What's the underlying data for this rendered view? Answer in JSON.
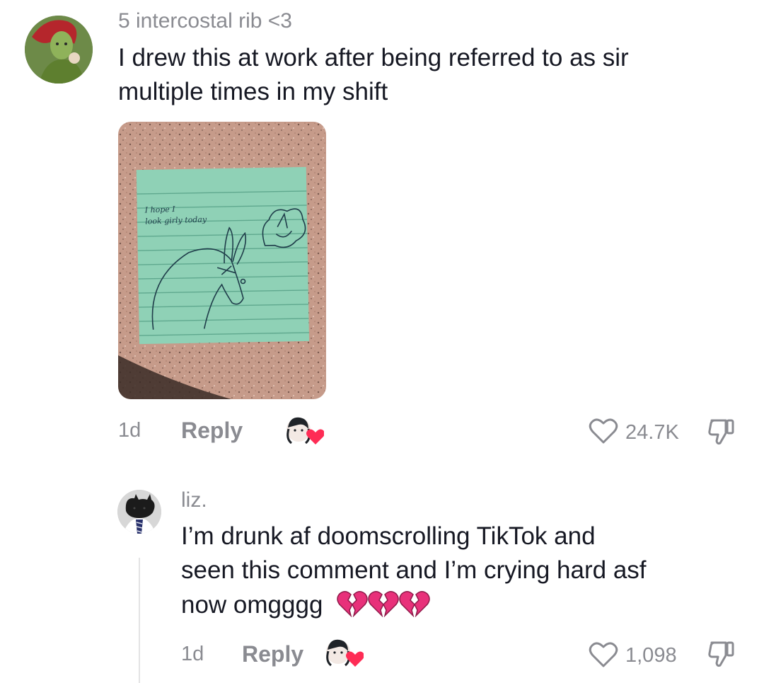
{
  "comments": [
    {
      "username": "5 intercostal rib <3",
      "text_line1": "I drew this at work after being referred to as sir",
      "text_line2": "multiple times in my shift",
      "image_alt": "sticky note drawing",
      "note_text_line1": "I hope I",
      "note_text_line2": "look girly today",
      "time": "1d",
      "reply_label": "Reply",
      "like_count": "24.7K"
    },
    {
      "username": "liz.",
      "text_line1": "I’m drunk af doomscrolling TikTok and",
      "text_line2": "seen this comment and I’m crying hard asf",
      "text_line3": "now omgggg",
      "emoji": "💔💔💔",
      "time": "1d",
      "reply_label": "Reply",
      "like_count": "1,098"
    }
  ],
  "icons": {
    "like": "heart-outline-icon",
    "dislike": "thumbs-down-icon",
    "creator_liked": "creator-liked-avatar-heart-icon",
    "broken_heart": "broken-heart-emoji"
  },
  "colors": {
    "text": "#161823",
    "muted": "#8a8b91",
    "heart_red": "#fe2c55",
    "broken_heart_pink": "#e8317a",
    "sticky_note": "#8fd1b6"
  }
}
